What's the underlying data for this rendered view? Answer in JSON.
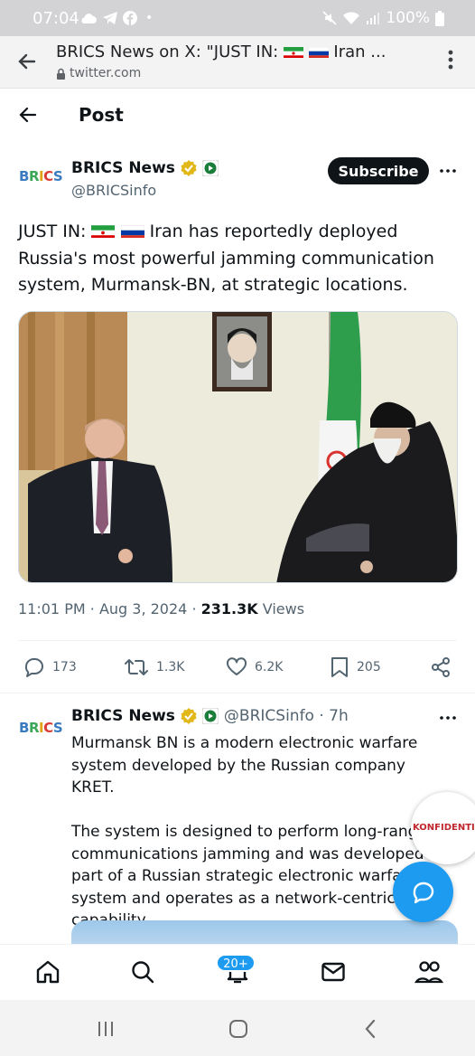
{
  "status_bar": {
    "time": "07:04",
    "dot": "•",
    "battery": "100%"
  },
  "browser": {
    "title_prefix": "BRICS News on X: \"JUST IN: ",
    "title_suffix": " Iran ...",
    "url": "twitter.com"
  },
  "post_header": {
    "title": "Post"
  },
  "tweet": {
    "logo_text": "BRICS",
    "author_name": "BRICS News",
    "handle": "@BRICSinfo",
    "subscribe_label": "Subscribe",
    "text_prefix": "JUST IN: ",
    "text_body": " Iran has reportedly deployed Russia's most powerful jamming communication system, Murmansk-BN, at strategic locations.",
    "time": "11:01 PM",
    "sep1": "·",
    "date": "Aug 3, 2024",
    "sep2": "·",
    "views_count": "231.3K",
    "views_label": "Views",
    "replies": "173",
    "reposts": "1.3K",
    "likes": "6.2K",
    "bookmarks": "205"
  },
  "reply": {
    "logo_text": "BRICS",
    "author_name": "BRICS News",
    "handle_time": "@BRICSinfo · 7h",
    "paragraph1": "Murmansk BN is a modern electronic warfare system developed by the Russian company KRET.",
    "paragraph2": "The system is designed to perform long-range communications jamming and was developed as part of a Russian strategic electronic warfare system and operates as a network-centric capability."
  },
  "floating_badge": {
    "text": "KONFIDENTIELL"
  },
  "tab_bar": {
    "notifications_badge": "20+"
  },
  "colors": {
    "accent": "#1d9bf0",
    "text": "#0f1419",
    "muted": "#536471",
    "verified_gold": "#e2b719"
  },
  "icons": [
    "back-arrow-icon",
    "lock-icon",
    "kebab-menu-icon",
    "verified-gold-icon",
    "affiliate-badge-icon",
    "reply-icon",
    "repost-icon",
    "like-icon",
    "bookmark-icon",
    "share-icon",
    "compose-icon",
    "home-icon",
    "search-icon",
    "notifications-icon",
    "messages-icon",
    "communities-icon"
  ]
}
